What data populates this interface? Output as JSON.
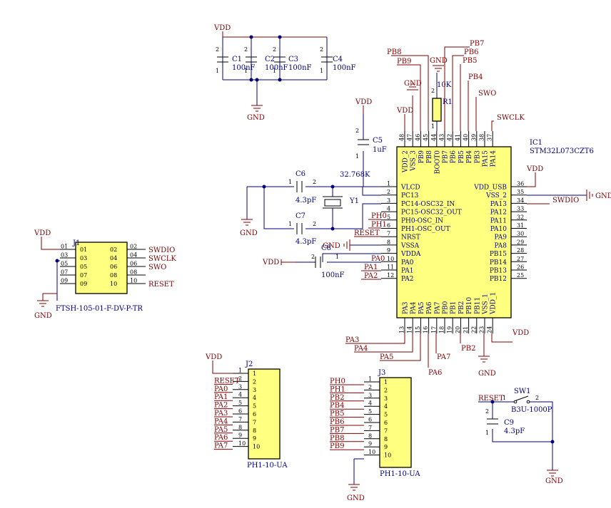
{
  "nets": {
    "vdd": "VDD",
    "gnd": "GND",
    "swdio": "SWDIO",
    "swclk": "SWCLK",
    "swo": "SWO",
    "reset": "RESET",
    "pb2": "PB2",
    "pb4": "PB4",
    "pb5": "PB5",
    "pb6": "PB6",
    "pb7": "PB7",
    "pb8": "PB8",
    "pb9": "PB9",
    "pa0": "PA0",
    "pa1": "PA1",
    "pa2": "PA2",
    "pa3": "PA3",
    "pa4": "PA4",
    "pa5": "PA5",
    "pa6": "PA6",
    "pa7": "PA7",
    "ph0": "PH0",
    "ph1": "PH1"
  },
  "components": {
    "c1": {
      "ref": "C1",
      "value": "100nF"
    },
    "c2": {
      "ref": "C2",
      "value": "100nF"
    },
    "c3": {
      "ref": "C3",
      "value": "100nF"
    },
    "c4": {
      "ref": "C4",
      "value": "100nF"
    },
    "c5": {
      "ref": "C5",
      "value": "1uF"
    },
    "c6": {
      "ref": "C6",
      "value": "4.3pF"
    },
    "c7": {
      "ref": "C7",
      "value": "4.3pF"
    },
    "c8": {
      "ref": "C8",
      "value": "100nF"
    },
    "c9": {
      "ref": "C9",
      "value": "4.3pF"
    },
    "r1": {
      "ref": "R1",
      "value": "10K"
    },
    "y1": {
      "ref": "Y1",
      "value": "32.768K"
    },
    "ic1": {
      "ref": "IC1",
      "value": "STM32L073CZT6"
    },
    "j1": {
      "ref": "J1",
      "value": "FTSH-105-01-F-DV-P-TR"
    },
    "j2": {
      "ref": "J2",
      "value": "PH1-10-UA"
    },
    "j3": {
      "ref": "J3",
      "value": "PH1-10-UA"
    },
    "sw1": {
      "ref": "SW1",
      "value": "B3U-1000P"
    }
  },
  "ic1_pins": {
    "left": [
      {
        "num": "1",
        "name": "VLCD"
      },
      {
        "num": "2",
        "name": "PC13"
      },
      {
        "num": "3",
        "name": "PC14-OSC32_IN"
      },
      {
        "num": "4",
        "name": "PC15-OSC32_OUT"
      },
      {
        "num": "5",
        "name": "PH0-OSC_IN"
      },
      {
        "num": "6",
        "name": "PH1-OSC_OUT"
      },
      {
        "num": "7",
        "name": "NRST"
      },
      {
        "num": "8",
        "name": "VSSA"
      },
      {
        "num": "9",
        "name": "VDDA"
      },
      {
        "num": "10",
        "name": "PA0"
      },
      {
        "num": "11",
        "name": "PA1"
      },
      {
        "num": "12",
        "name": "PA2"
      }
    ],
    "right": [
      {
        "num": "36",
        "name": "VDD_USB"
      },
      {
        "num": "35",
        "name": "VSS_2"
      },
      {
        "num": "34",
        "name": "PA13"
      },
      {
        "num": "33",
        "name": "PA12"
      },
      {
        "num": "32",
        "name": "PA11"
      },
      {
        "num": "31",
        "name": "PA10"
      },
      {
        "num": "30",
        "name": "PA9"
      },
      {
        "num": "29",
        "name": "PA8"
      },
      {
        "num": "28",
        "name": "PB15"
      },
      {
        "num": "27",
        "name": "PB14"
      },
      {
        "num": "26",
        "name": "PB13"
      },
      {
        "num": "25",
        "name": "PB12"
      }
    ],
    "top": [
      {
        "num": "48",
        "name": "VDD_2"
      },
      {
        "num": "47",
        "name": "VSS_3"
      },
      {
        "num": "46",
        "name": "PB9"
      },
      {
        "num": "45",
        "name": "PB8"
      },
      {
        "num": "44",
        "name": "BOOT0"
      },
      {
        "num": "43",
        "name": "PB7"
      },
      {
        "num": "42",
        "name": "PB6"
      },
      {
        "num": "41",
        "name": "PB5"
      },
      {
        "num": "40",
        "name": "PB4"
      },
      {
        "num": "39",
        "name": "PB3"
      },
      {
        "num": "38",
        "name": "PA15"
      },
      {
        "num": "37",
        "name": "PA14"
      }
    ],
    "bottom": [
      {
        "num": "13",
        "name": "PA3"
      },
      {
        "num": "14",
        "name": "PA4"
      },
      {
        "num": "15",
        "name": "PA5"
      },
      {
        "num": "16",
        "name": "PA6"
      },
      {
        "num": "17",
        "name": "PA7"
      },
      {
        "num": "18",
        "name": "PB0"
      },
      {
        "num": "19",
        "name": "PB1"
      },
      {
        "num": "20",
        "name": "PB2"
      },
      {
        "num": "21",
        "name": "PB10"
      },
      {
        "num": "22",
        "name": "PB11"
      },
      {
        "num": "23",
        "name": "VSS_1"
      },
      {
        "num": "24",
        "name": "VDD_1"
      }
    ]
  },
  "j1_pins": {
    "left": [
      "01",
      "03",
      "05",
      "07",
      "09"
    ],
    "right": [
      "02",
      "04",
      "06",
      "08",
      "10"
    ]
  },
  "j2_pins": [
    "1",
    "2",
    "3",
    "4",
    "5",
    "6",
    "7",
    "8",
    "9",
    "10"
  ],
  "j2_nets": [
    "",
    "RESET",
    "PA0",
    "PA1",
    "PA2",
    "PA3",
    "PA4",
    "PA5",
    "PA6",
    "PA7"
  ],
  "j3_pins": [
    "1",
    "2",
    "3",
    "4",
    "5",
    "6",
    "7",
    "8",
    "9",
    "10"
  ],
  "j3_nets": [
    "PH0",
    "PH1",
    "PB2",
    "PB4",
    "PB5",
    "PB6",
    "PB7",
    "PB8",
    "PB9",
    ""
  ],
  "pin_numbers": {
    "one": "1",
    "two": "2"
  }
}
